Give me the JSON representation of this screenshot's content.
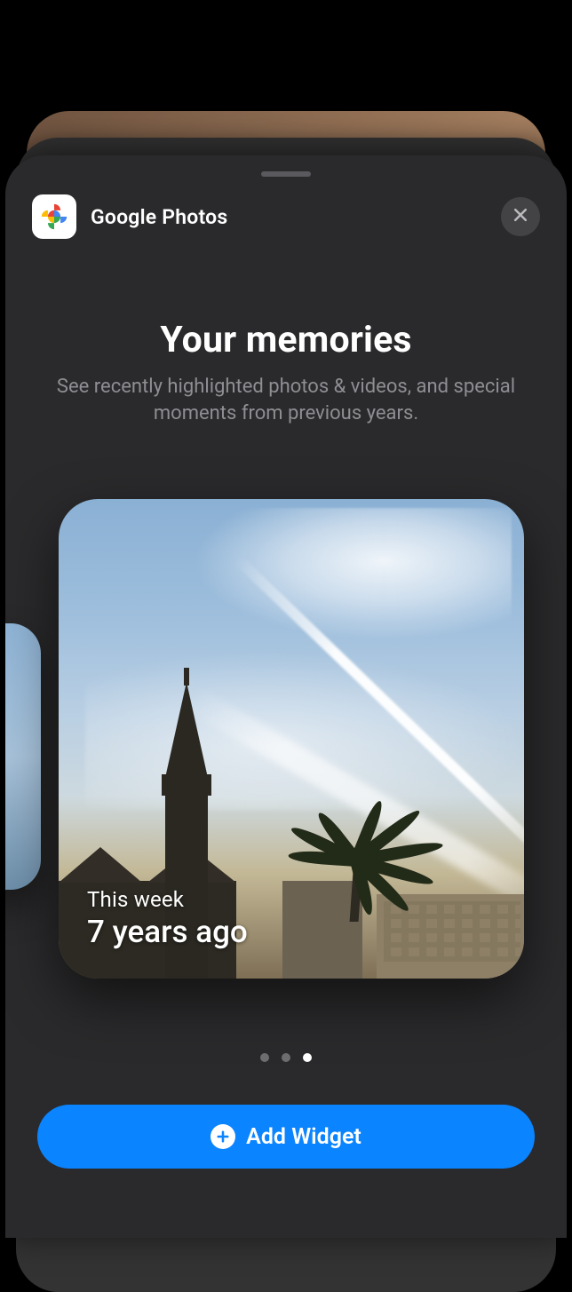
{
  "app": {
    "name": "Google Photos",
    "icon": "google-photos-pinwheel"
  },
  "headline": {
    "title": "Your memories",
    "subtitle": "See recently highlighted photos & videos, and special moments from previous years."
  },
  "widget_preview": {
    "label_line1": "This week",
    "label_line2": "7 years ago"
  },
  "pagination": {
    "total": 3,
    "current_index": 2
  },
  "primary_action": {
    "label": "Add Widget"
  },
  "colors": {
    "accent": "#0b84ff",
    "sheet_bg": "#2a2a2c",
    "secondary_text": "#8e8e93"
  }
}
